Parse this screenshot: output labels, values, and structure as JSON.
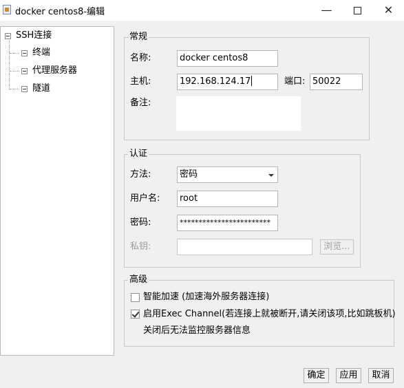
{
  "window": {
    "title": "docker centos8-编辑",
    "minimize_glyph": "—",
    "close_glyph": "✕"
  },
  "tree": {
    "root": {
      "label": "SSH连接"
    },
    "children": [
      {
        "label": "终端"
      },
      {
        "label": "代理服务器"
      },
      {
        "label": "隧道"
      }
    ]
  },
  "general": {
    "title": "常规",
    "name_label": "名称:",
    "name_value": "docker centos8",
    "host_label": "主机:",
    "host_value": "192.168.124.17",
    "port_label": "端口:",
    "port_value": "50022",
    "note_label": "备注:",
    "note_value": ""
  },
  "auth": {
    "title": "认证",
    "method_label": "方法:",
    "method_value": "密码",
    "username_label": "用户名:",
    "username_value": "root",
    "password_label": "密码:",
    "password_value": "************************",
    "key_label": "私钥:",
    "key_value": "",
    "browse_label": "浏览..."
  },
  "advanced": {
    "title": "高级",
    "smart_accel": {
      "label": "智能加速 (加速海外服务器连接)",
      "checked": false
    },
    "exec_channel": {
      "label": "启用Exec Channel(若连接上就被断开,请关闭该项,比如跳板机)",
      "checked": true
    },
    "exec_note": "关闭后无法监控服务器信息"
  },
  "footer": {
    "ok_label": "确定",
    "apply_label": "应用",
    "cancel_label": "取消"
  }
}
